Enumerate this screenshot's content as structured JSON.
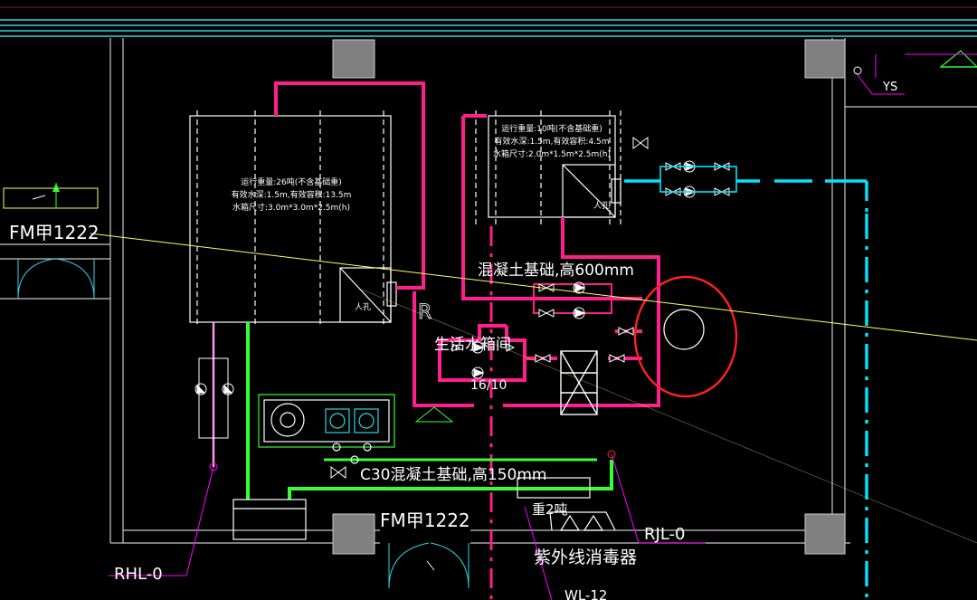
{
  "colors": {
    "background": "#000000",
    "wall": "#c8c8c8",
    "hot_water": "#ff1e8c",
    "cold_water": "#00e5ff",
    "drain": "#33ff33",
    "equipment": "#ffffff",
    "leader": "#ff00ff",
    "text": "#ffffff",
    "highlight": "#ff2020",
    "trace_line": "#ffff66",
    "column_fill": "#808080"
  },
  "labels": {
    "left_tank_line1": "运行重量:26吨(不含基础重)",
    "left_tank_line2": "有效水深:1.5m,有效容积:13.5m",
    "left_tank_line3": "水箱尺寸:3.0m*3.0m*2.5m(h)",
    "right_tank_line1": "运行重量:10吨(不含基础重)",
    "right_tank_line2": "有效水深:1.5m,有效容积:4.5m",
    "right_tank_line3": "水箱尺寸:2.0m*1.5m*2.5m(h)",
    "manhole_left": "人孔",
    "manhole_right": "人孔",
    "foundation_600": "混凝土基础,高600mm",
    "domestic_tank": "生活水箱间",
    "room_no": "16/10",
    "foundation_150": "C30混凝土基础,高150mm",
    "door_left": "FM甲1222",
    "door_bottom": "FM甲1222",
    "weight_2t": "重2吨",
    "uv_sterilizer": "紫外线消毒器",
    "tag_ys": "YS",
    "tag_rjl": "RJL-0",
    "tag_rhl": "RHL-0",
    "tag_wl": "WL-12"
  }
}
